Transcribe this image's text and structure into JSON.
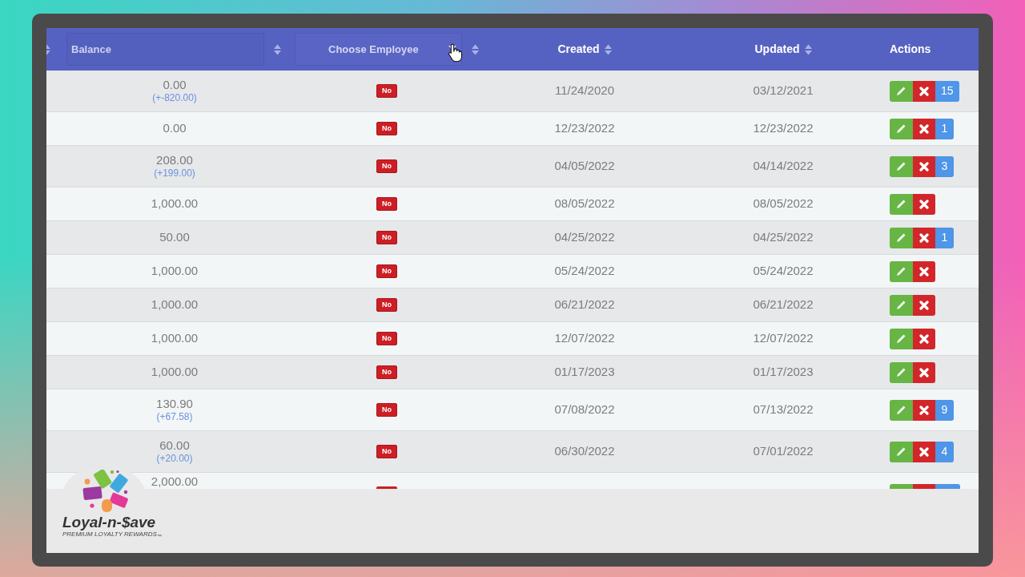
{
  "header": {
    "columns": [
      {
        "kind": "input",
        "placeholder": "Balance",
        "sortable": true
      },
      {
        "kind": "select",
        "value": "Choose Employee",
        "sortable": true
      },
      {
        "kind": "label",
        "label": "Created",
        "sortable": true
      },
      {
        "kind": "label",
        "label": "Updated",
        "sortable": true
      },
      {
        "kind": "label",
        "label": "Actions",
        "sortable": false
      }
    ]
  },
  "rows": [
    {
      "balance": "0.00",
      "change": "(+-820.00)",
      "employee": "No",
      "created": "11/24/2020",
      "updated": "03/12/2021",
      "count": "15"
    },
    {
      "balance": "0.00",
      "employee": "No",
      "created": "12/23/2022",
      "updated": "12/23/2022",
      "count": "1"
    },
    {
      "balance": "208.00",
      "change": "(+199.00)",
      "employee": "No",
      "created": "04/05/2022",
      "updated": "04/14/2022",
      "count": "3"
    },
    {
      "balance": "1,000.00",
      "employee": "No",
      "created": "08/05/2022",
      "updated": "08/05/2022"
    },
    {
      "balance": "50.00",
      "employee": "No",
      "created": "04/25/2022",
      "updated": "04/25/2022",
      "count": "1"
    },
    {
      "balance": "1,000.00",
      "employee": "No",
      "created": "05/24/2022",
      "updated": "05/24/2022"
    },
    {
      "balance": "1,000.00",
      "employee": "No",
      "created": "06/21/2022",
      "updated": "06/21/2022"
    },
    {
      "balance": "1,000.00",
      "employee": "No",
      "created": "12/07/2022",
      "updated": "12/07/2022"
    },
    {
      "balance": "1,000.00",
      "employee": "No",
      "created": "01/17/2023",
      "updated": "01/17/2023"
    },
    {
      "balance": "130.90",
      "change": "(+67.58)",
      "employee": "No",
      "created": "07/08/2022",
      "updated": "07/13/2022",
      "count": "9"
    },
    {
      "balance": "60.00",
      "change": "(+20.00)",
      "employee": "No",
      "created": "06/30/2022",
      "updated": "07/01/2022",
      "count": "4"
    }
  ],
  "partial_row": {
    "balance": "2,000.00"
  },
  "logo": {
    "name": "Loyal-n-$ave",
    "tagline": "PREMIUM LOYALTY REWARDS$_{™}$"
  }
}
